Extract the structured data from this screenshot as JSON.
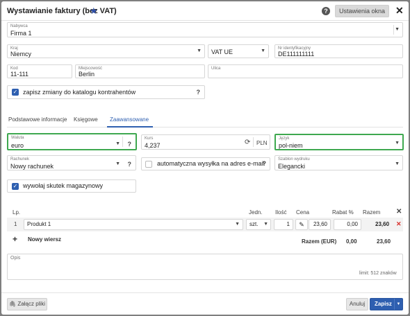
{
  "dialog": {
    "title": "Wystawianie faktury (bez VAT)",
    "settings_label": "Ustawienia okna"
  },
  "buyer": {
    "label": "Nabywca",
    "value": "Firma 1"
  },
  "country": {
    "label": "Kraj",
    "value": "Niemcy"
  },
  "vat_type": {
    "value": "VAT UE"
  },
  "tax_id": {
    "label": "Nr identyfikacyjny",
    "value": "DE111111111"
  },
  "postal_code": {
    "label": "Kod",
    "value": "11-111"
  },
  "city": {
    "label": "Miejscowość",
    "value": "Berlin"
  },
  "street": {
    "label": "Ulica",
    "value": ""
  },
  "save_contractor": {
    "label": "zapisz zmiany do katalogu kontrahentów",
    "checked": true
  },
  "tabs": [
    {
      "label": "Podstawowe informacje"
    },
    {
      "label": "Księgowe"
    },
    {
      "label": "Zaawansowane",
      "active": true
    }
  ],
  "currency": {
    "label": "Waluta",
    "value": "euro"
  },
  "rate": {
    "label": "Kurs",
    "value": "4,237",
    "unit": "PLN"
  },
  "language": {
    "label": "Język",
    "value": "pol-niem"
  },
  "account": {
    "label": "Rachunek",
    "value": "Nowy rachunek"
  },
  "auto_send": {
    "label": "automatyczna wysyłka na adres e-mail",
    "checked": false
  },
  "print_template": {
    "label": "Szablon wydruku",
    "value": "Elegancki"
  },
  "warehouse": {
    "label": "wywołaj skutek magazynowy",
    "checked": true
  },
  "table": {
    "headers": {
      "lp": "Lp.",
      "unit": "Jedn.",
      "qty": "Ilość",
      "price": "Cena",
      "discount": "Rabat %",
      "total": "Razem"
    },
    "rows": [
      {
        "lp": "1",
        "product": "Produkt 1",
        "unit": "szt.",
        "qty": "1",
        "price": "23,60",
        "discount": "0,00",
        "total": "23,60"
      }
    ],
    "new_row_label": "Nowy wiersz",
    "summary_label": "Razem (EUR)",
    "summary_discount": "0,00",
    "summary_total": "23,60"
  },
  "description": {
    "label": "Opis",
    "value": "",
    "limit": "limit: 512 znaków"
  },
  "footer": {
    "attach_label": "Załącz pliki",
    "cancel_label": "Anuluj",
    "save_label": "Zapisz"
  },
  "colors": {
    "accent": "#2e5fb0",
    "highlight": "#3ea84f",
    "delete": "#d9302c"
  }
}
